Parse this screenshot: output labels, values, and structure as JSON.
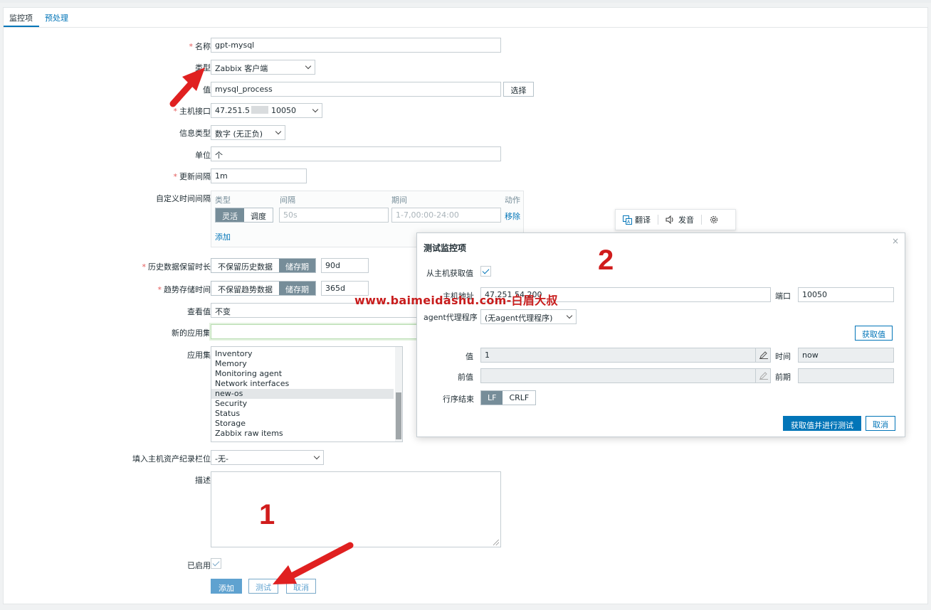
{
  "tabs": [
    "监控项",
    "预处理"
  ],
  "form": {
    "name_label": "名称",
    "name_value": "gpt-mysql",
    "type_label": "类型",
    "type_value": "Zabbix 客户端",
    "key_label_partial": "值",
    "key_value": "mysql_process",
    "select_button": "选择",
    "host_iface_label": "主机接口",
    "host_iface_ip": "47.251.5",
    "host_iface_port": "10050",
    "info_type_label": "信息类型",
    "info_type_value": "数字 (无正负)",
    "units_label": "单位",
    "units_value": "个",
    "interval_label": "更新间隔",
    "interval_value": "1m",
    "custom_intervals_label": "自定义时间间隔",
    "custom_intervals": {
      "col_type": "类型",
      "col_interval": "间隔",
      "col_period": "期间",
      "col_action": "动作",
      "flex_label": "灵活",
      "sched_label": "调度",
      "interval_placeholder": "50s",
      "period_placeholder": "1-7,00:00-24:00",
      "remove_link": "移除",
      "add_link": "添加"
    },
    "history_label": "历史数据保留时长",
    "history_no_keep": "不保留历史数据",
    "history_store": "储存期",
    "history_value": "90d",
    "trends_label": "趋势存储时间",
    "trends_no_keep": "不保留趋势数据",
    "trends_store": "储存期",
    "trends_value": "365d",
    "valuemap_label": "查看值",
    "valuemap_value": "不变",
    "new_app_label": "新的应用集",
    "apps_label": "应用集",
    "apps": [
      "Inventory",
      "Memory",
      "Monitoring agent",
      "Network interfaces",
      "new-os",
      "Security",
      "Status",
      "Storage",
      "Zabbix raw items"
    ],
    "apps_selected": "new-os",
    "inventory_label": "填入主机资产纪录栏位",
    "inventory_value": "-无-",
    "desc_label": "描述",
    "enabled_label": "已启用",
    "btn_add": "添加",
    "btn_test": "测试",
    "btn_cancel": "取消"
  },
  "translate_bar": {
    "translate": "翻译",
    "pronounce": "发音"
  },
  "modal": {
    "title": "测试监控项",
    "close": "×",
    "get_from_host_label": "从主机获取值",
    "host_addr_label": "主机地址",
    "host_addr_value": "47.251.54.200",
    "port_label": "端口",
    "port_value": "10050",
    "proxy_label": "agent代理程序",
    "proxy_value": "(无agent代理程序)",
    "get_value_button": "获取值",
    "value_label": "值",
    "value_value": "1",
    "time_label": "时间",
    "time_value": "now",
    "prev_value_label": "前值",
    "prev_time_label": "前期",
    "eol_label": "行序结束",
    "eol_lf": "LF",
    "eol_crlf": "CRLF",
    "test_button": "获取值并进行测试",
    "cancel_button": "取消"
  },
  "annotations": {
    "watermark": "www.baimeidashu.com-白眉大叔",
    "num1": "1",
    "num2": "2",
    "arrow_color": "#e02020"
  }
}
